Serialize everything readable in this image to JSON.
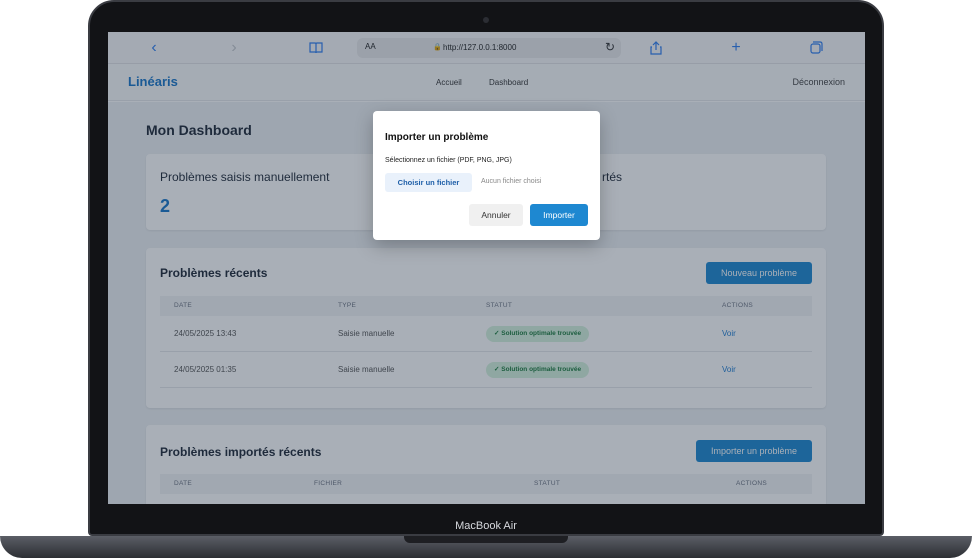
{
  "device": {
    "label": "MacBook Air"
  },
  "browser": {
    "url": "http://127.0.0.1:8000",
    "text_size": "AA",
    "icons": [
      "back-icon",
      "forward-icon",
      "bookmarks-icon",
      "reload-icon",
      "share-icon",
      "new-tab-icon",
      "tabs-icon"
    ]
  },
  "nav": {
    "brand": "Linéaris",
    "links": [
      "Accueil",
      "Dashboard"
    ],
    "logout": "Déconnexion"
  },
  "dashboard": {
    "title": "Mon Dashboard",
    "stats": [
      {
        "label": "Problèmes saisis manuellement",
        "value": "2"
      },
      {
        "label": "rtés",
        "value": ""
      }
    ],
    "recent": {
      "title": "Problèmes récents",
      "button": "Nouveau problème",
      "columns": [
        "DATE",
        "TYPE",
        "STATUT",
        "ACTIONS"
      ],
      "rows": [
        {
          "date": "24/05/2025 13:43",
          "type": "Saisie manuelle",
          "status": "Solution optimale trouvée",
          "action": "Voir"
        },
        {
          "date": "24/05/2025 01:35",
          "type": "Saisie manuelle",
          "status": "Solution optimale trouvée",
          "action": "Voir"
        }
      ]
    },
    "imported": {
      "title": "Problèmes importés récents",
      "button": "Importer un problème",
      "columns": [
        "DATE",
        "FICHIER",
        "STATUT",
        "ACTIONS"
      ]
    }
  },
  "modal": {
    "title": "Importer un problème",
    "label": "Sélectionnez un fichier (PDF, PNG, JPG)",
    "choose_file": "Choisir un fichier",
    "no_file": "Aucun fichier choisi",
    "cancel": "Annuler",
    "submit": "Importer"
  },
  "colors": {
    "accent": "#1e88d1",
    "brand": "#1976c9",
    "success_bg": "#d5f2dd",
    "success_text": "#1e7c3f"
  }
}
